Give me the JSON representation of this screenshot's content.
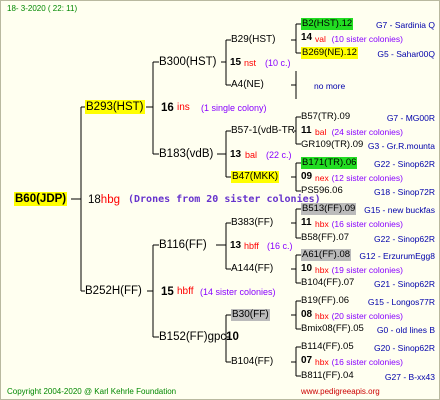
{
  "header": {
    "stamp": "18-  3-2020 ( 22: 11)"
  },
  "footer": {
    "copyright": "Copyright 2004-2020 @ Karl Kehrle Foundation",
    "site": "www.pedigreeapis.org"
  },
  "root": {
    "name": "B60(JDP)",
    "gen": "18",
    "loc": "hbg",
    "note": "(Drones from 20 sister colonies)"
  },
  "parents": [
    {
      "name": "B293(HST)",
      "gen": "16",
      "loc": "ins",
      "note": "(1 single colony)"
    },
    {
      "name": "B252H(FF)",
      "gen": "15",
      "loc": "hbff",
      "note": "(14 sister colonies)"
    }
  ],
  "grandparents": [
    {
      "name": "B300(HST)",
      "gen": "15",
      "loc": "nst",
      "note": "(10 c.)"
    },
    {
      "name": "B183(vdB)",
      "gen": "13",
      "loc": "bal",
      "note": "(22 c.)"
    },
    {
      "name": "B116(FF)",
      "gen": "13",
      "loc": "hbff",
      "note": "(16 c.)"
    },
    {
      "name": "B152(FF)gpc",
      "gen": "10",
      "loc": "",
      "note": ""
    }
  ],
  "greatgrandparents": [
    {
      "name": "B29(HST)"
    },
    {
      "name": "A4(NE)",
      "note": "no more"
    },
    {
      "name": "B57-1(vdB-TR"
    },
    {
      "name": "B47(MKK)"
    },
    {
      "name": "B383(FF)"
    },
    {
      "name": "A144(FF)"
    },
    {
      "name": "B30(FF)"
    },
    {
      "name": "B104(FF)"
    }
  ],
  "leaves": [
    {
      "name": "B2(HST).12",
      "desc": "G7 - Sardinia Q"
    },
    {
      "gen": "14",
      "loc": "val",
      "note": "(10 sister colonies)"
    },
    {
      "name": "B269(NE).12",
      "desc": "G5 - Sahar00Q"
    },
    {
      "name": "B57(TR).09",
      "desc": "G7 - MG00R"
    },
    {
      "gen": "11",
      "loc": "bal",
      "note": "(24 sister colonies)"
    },
    {
      "name": "GR109(TR).09",
      "desc": "G3 - Gr.R.mounta"
    },
    {
      "name": "B171(TR).06",
      "desc": "G22 - Sinop62R"
    },
    {
      "gen": "09",
      "loc": "nex",
      "note": "(12 sister colonies)"
    },
    {
      "name": "PS596.06",
      "desc": "G18 - Sinop72R"
    },
    {
      "name": "B513(FF).09",
      "desc": "G15 - new buckfas"
    },
    {
      "gen": "11",
      "loc": "hbx",
      "note": "(16 sister colonies)"
    },
    {
      "name": "B58(FF).07",
      "desc": "G22 - Sinop62R"
    },
    {
      "name": "A61(FF).08",
      "desc": "G12 - ErzurumEgg8"
    },
    {
      "gen": "10",
      "loc": "hbx",
      "note": "(19 sister colonies)"
    },
    {
      "name": "B104(FF).07",
      "desc": "G21 - Sinop62R"
    },
    {
      "name": "B19(FF).06",
      "desc": "G15 - Longos77R"
    },
    {
      "gen": "08",
      "loc": "hbx",
      "note": "(20 sister colonies)"
    },
    {
      "name": "Bmix08(FF).05",
      "desc": "G0 - old lines B"
    },
    {
      "name": "B114(FF).05",
      "desc": "G20 - Sinop62R"
    },
    {
      "gen": "07",
      "loc": "hbx",
      "note": "(16 sister colonies)"
    },
    {
      "name": "B811(FF).04",
      "desc": "G27 - B-xx43"
    }
  ]
}
